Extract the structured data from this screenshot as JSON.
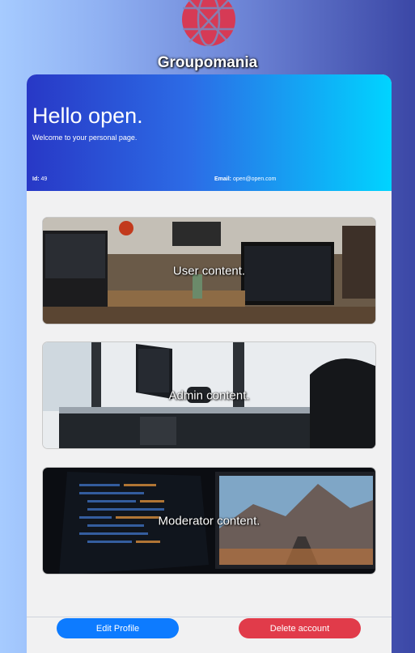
{
  "brand": {
    "name": "Groupomania",
    "logo_icon": "globe-icon",
    "logo_color": "#d63a55"
  },
  "profile": {
    "greeting": "Hello",
    "username": "open.",
    "welcome": "Welcome to your personal page.",
    "id_label": "Id:",
    "id_value": "49",
    "email_label": "Email:",
    "email_value": "open@open.com"
  },
  "tiles": [
    {
      "label": "User content.",
      "image": "office-desks-photo"
    },
    {
      "label": "Admin content.",
      "image": "monitor-desk-photo"
    },
    {
      "label": "Moderator content.",
      "image": "code-monitors-photo"
    }
  ],
  "actions": {
    "edit_label": "Edit Profile",
    "delete_label": "Delete account",
    "edit_color": "#0d7bff",
    "delete_color": "#e13b4a"
  }
}
